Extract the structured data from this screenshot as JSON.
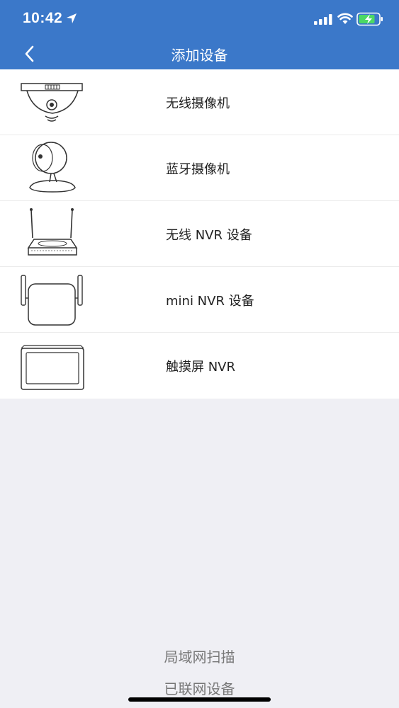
{
  "status_bar": {
    "time": "10:42",
    "icons": [
      "location-arrow-icon",
      "cellular-signal-icon",
      "wifi-icon",
      "battery-charging-icon"
    ],
    "battery_color": "#4cd964"
  },
  "header": {
    "title": "添加设备",
    "background": "#3b78c9",
    "back_icon": "chevron-left-icon"
  },
  "devices": [
    {
      "label": "无线摄像机",
      "icon": "wireless-ceiling-camera-icon"
    },
    {
      "label": "蓝牙摄像机",
      "icon": "bluetooth-camera-icon"
    },
    {
      "label": "无线 NVR 设备",
      "icon": "wireless-nvr-icon"
    },
    {
      "label": "mini NVR 设备",
      "icon": "mini-nvr-icon"
    },
    {
      "label": "触摸屏 NVR",
      "icon": "touchscreen-nvr-icon"
    }
  ],
  "footer": {
    "lan_scan": "局域网扫描",
    "connected_devices": "已联网设备"
  }
}
